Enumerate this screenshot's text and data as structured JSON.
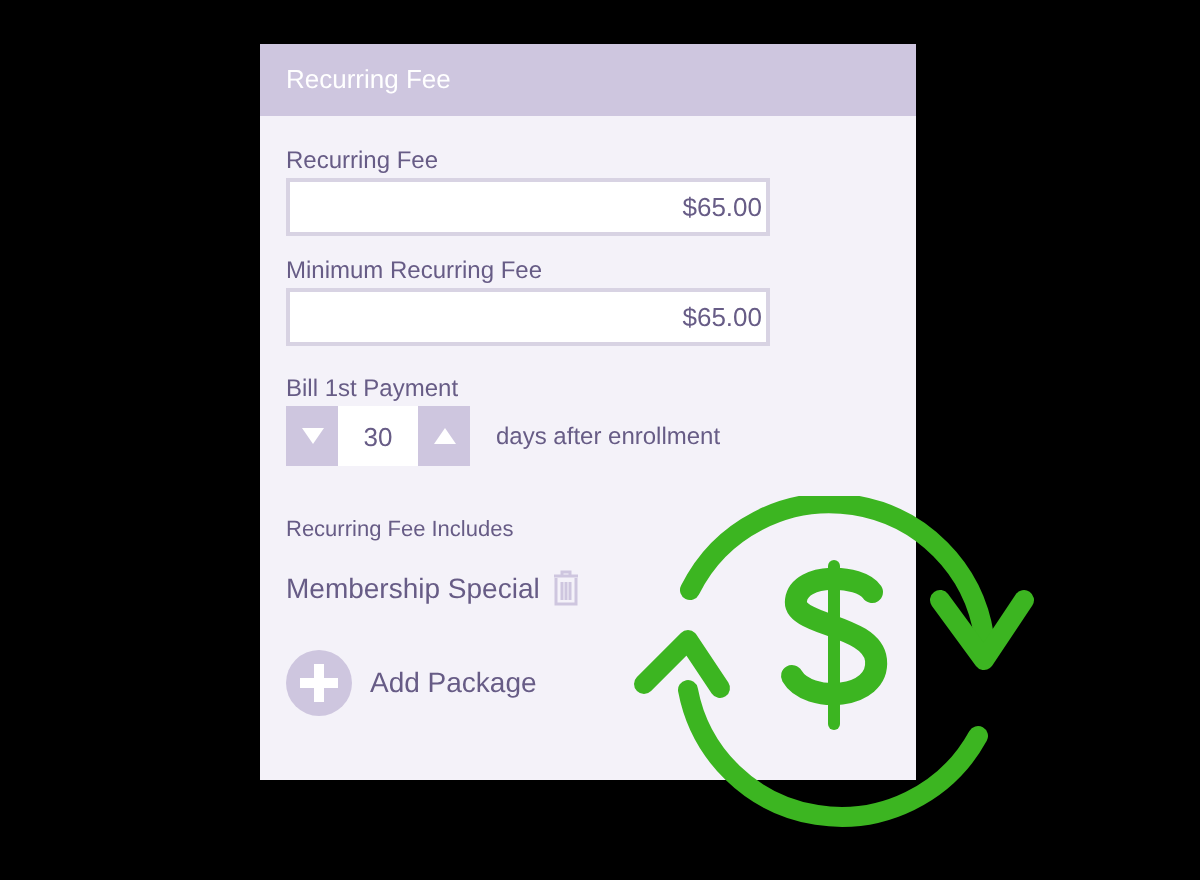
{
  "card": {
    "title": "Recurring Fee"
  },
  "fields": [
    {
      "label": "Recurring Fee",
      "value": "$65.00"
    },
    {
      "label": "Minimum Recurring Fee",
      "value": "$65.00"
    }
  ],
  "bill": {
    "label": "Bill 1st Payment",
    "value": "30",
    "suffix": "days after enrollment"
  },
  "includes": {
    "label": "Recurring Fee Includes",
    "items": [
      "Membership Special"
    ]
  },
  "add_button": "Add Package"
}
